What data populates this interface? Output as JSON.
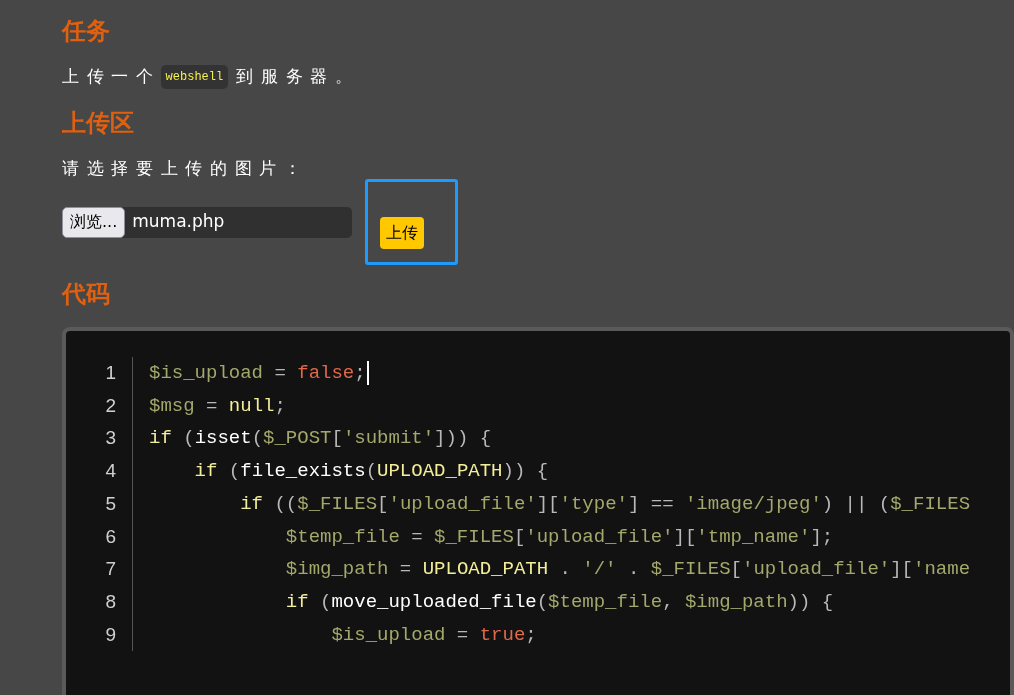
{
  "task": {
    "heading": "任务",
    "text_before": "上传一个",
    "code": "webshell",
    "text_after": "到服务器。"
  },
  "upload": {
    "heading": "上传区",
    "prompt": "请选择要上传的图片：",
    "browse_label": "浏览...",
    "file_name": "muma.php",
    "submit_label": "上传",
    "submit_focused": true
  },
  "code": {
    "heading": "代码",
    "lines": [
      {
        "number": "1",
        "tokens": [
          {
            "kind": "var",
            "t": "$is_upload"
          },
          {
            "kind": "op",
            "t": " = "
          },
          {
            "kind": "bool",
            "t": "false"
          },
          {
            "kind": "op",
            "t": ";"
          }
        ],
        "cursor": true
      },
      {
        "number": "2",
        "tokens": [
          {
            "kind": "var",
            "t": "$msg"
          },
          {
            "kind": "op",
            "t": " = "
          },
          {
            "kind": "kw",
            "t": "null"
          },
          {
            "kind": "op",
            "t": ";"
          }
        ],
        "cursor": false
      },
      {
        "number": "3",
        "tokens": [
          {
            "kind": "kw",
            "t": "if"
          },
          {
            "kind": "op",
            "t": " ("
          },
          {
            "kind": "fn",
            "t": "isset"
          },
          {
            "kind": "op",
            "t": "("
          },
          {
            "kind": "var",
            "t": "$_POST"
          },
          {
            "kind": "op",
            "t": "["
          },
          {
            "kind": "str",
            "t": "'submit'"
          },
          {
            "kind": "op",
            "t": "])) {"
          }
        ],
        "cursor": false
      },
      {
        "number": "4",
        "tokens": [
          {
            "kind": "kw",
            "t": "    if"
          },
          {
            "kind": "op",
            "t": " ("
          },
          {
            "kind": "fn",
            "t": "file_exists"
          },
          {
            "kind": "op",
            "t": "("
          },
          {
            "kind": "kw",
            "t": "UPLOAD_PATH"
          },
          {
            "kind": "op",
            "t": ")) {"
          }
        ],
        "cursor": false
      },
      {
        "number": "5",
        "tokens": [
          {
            "kind": "kw",
            "t": "        if"
          },
          {
            "kind": "op",
            "t": " (("
          },
          {
            "kind": "var",
            "t": "$_FILES"
          },
          {
            "kind": "op",
            "t": "["
          },
          {
            "kind": "str",
            "t": "'upload_file'"
          },
          {
            "kind": "op",
            "t": "]["
          },
          {
            "kind": "str",
            "t": "'type'"
          },
          {
            "kind": "op",
            "t": "] == "
          },
          {
            "kind": "str",
            "t": "'image/jpeg'"
          },
          {
            "kind": "op",
            "t": ") || ("
          },
          {
            "kind": "var",
            "t": "$_FILES"
          }
        ],
        "cursor": false
      },
      {
        "number": "6",
        "tokens": [
          {
            "kind": "var",
            "t": "            $temp_file"
          },
          {
            "kind": "op",
            "t": " = "
          },
          {
            "kind": "var",
            "t": "$_FILES"
          },
          {
            "kind": "op",
            "t": "["
          },
          {
            "kind": "str",
            "t": "'upload_file'"
          },
          {
            "kind": "op",
            "t": "]["
          },
          {
            "kind": "str",
            "t": "'tmp_name'"
          },
          {
            "kind": "op",
            "t": "];"
          }
        ],
        "cursor": false
      },
      {
        "number": "7",
        "tokens": [
          {
            "kind": "var",
            "t": "            $img_path"
          },
          {
            "kind": "op",
            "t": " = "
          },
          {
            "kind": "kw",
            "t": "UPLOAD_PATH"
          },
          {
            "kind": "op",
            "t": " . "
          },
          {
            "kind": "str",
            "t": "'/'"
          },
          {
            "kind": "op",
            "t": " . "
          },
          {
            "kind": "var",
            "t": "$_FILES"
          },
          {
            "kind": "op",
            "t": "["
          },
          {
            "kind": "str",
            "t": "'upload_file'"
          },
          {
            "kind": "op",
            "t": "]["
          },
          {
            "kind": "str",
            "t": "'name"
          }
        ],
        "cursor": false
      },
      {
        "number": "8",
        "tokens": [
          {
            "kind": "kw",
            "t": "            if"
          },
          {
            "kind": "op",
            "t": " ("
          },
          {
            "kind": "fn",
            "t": "move_uploaded_file"
          },
          {
            "kind": "op",
            "t": "("
          },
          {
            "kind": "var",
            "t": "$temp_file"
          },
          {
            "kind": "op",
            "t": ", "
          },
          {
            "kind": "var",
            "t": "$img_path"
          },
          {
            "kind": "op",
            "t": ")) {"
          }
        ],
        "cursor": false
      },
      {
        "number": "9",
        "tokens": [
          {
            "kind": "var",
            "t": "                $is_upload"
          },
          {
            "kind": "op",
            "t": " = "
          },
          {
            "kind": "bool",
            "t": "true"
          },
          {
            "kind": "op",
            "t": ";"
          }
        ],
        "cursor": false
      }
    ]
  }
}
